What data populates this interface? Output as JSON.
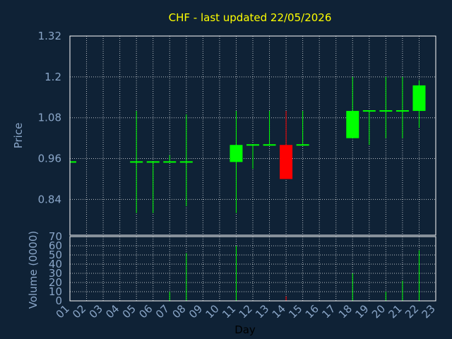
{
  "chart_data": {
    "type": "candlestick",
    "title": "CHF - last updated 22/05/2026",
    "xlabel": "Day",
    "ylabel": "Price",
    "volume_label": "Volume (0000)",
    "x_ticks": [
      "01",
      "02",
      "03",
      "04",
      "05",
      "06",
      "07",
      "08",
      "09",
      "10",
      "11",
      "12",
      "13",
      "14",
      "15",
      "16",
      "17",
      "18",
      "19",
      "20",
      "21",
      "22",
      "23"
    ],
    "price_ticks": [
      0.84,
      0.96,
      1.08,
      1.2,
      1.32
    ],
    "price_tick_labels": [
      "0.84",
      "0.96",
      "1.08",
      "1.2",
      "1.32"
    ],
    "price_range": [
      0.735,
      1.32
    ],
    "volume_ticks": [
      0,
      10,
      20,
      30,
      40,
      50,
      60,
      70
    ],
    "volume_range": [
      0,
      70
    ],
    "grid": true,
    "colors": {
      "background": "#0f2236",
      "up": "#00ff00",
      "down": "#ff0000",
      "grid": "#ffffff",
      "axis": "#8aa6c8",
      "title": "#ffff00"
    },
    "candles": [
      {
        "day": "01",
        "open": 0.95,
        "close": 0.95,
        "high": 0.95,
        "low": 0.95,
        "volume": 0
      },
      {
        "day": "05",
        "open": 0.95,
        "close": 0.95,
        "high": 1.1,
        "low": 0.8,
        "volume": 0
      },
      {
        "day": "06",
        "open": 0.95,
        "close": 0.95,
        "high": 0.95,
        "low": 0.8,
        "volume": 0
      },
      {
        "day": "07",
        "open": 0.95,
        "close": 0.95,
        "high": 0.97,
        "low": 0.95,
        "volume": 10
      },
      {
        "day": "08",
        "open": 0.95,
        "close": 0.95,
        "high": 1.09,
        "low": 0.82,
        "volume": 52
      },
      {
        "day": "11",
        "open": 0.95,
        "close": 1.0,
        "high": 1.1,
        "low": 0.8,
        "volume": 60
      },
      {
        "day": "12",
        "open": 1.0,
        "close": 1.0,
        "high": 1.0,
        "low": 0.93,
        "volume": 0
      },
      {
        "day": "13",
        "open": 1.0,
        "close": 1.0,
        "high": 1.1,
        "low": 1.0,
        "volume": 0
      },
      {
        "day": "14",
        "open": 1.0,
        "close": 0.9,
        "high": 1.1,
        "low": 0.9,
        "volume": 5
      },
      {
        "day": "15",
        "open": 1.0,
        "close": 1.0,
        "high": 1.1,
        "low": 1.0,
        "volume": 0
      },
      {
        "day": "18",
        "open": 1.02,
        "close": 1.1,
        "high": 1.2,
        "low": 1.02,
        "volume": 30
      },
      {
        "day": "19",
        "open": 1.1,
        "close": 1.1,
        "high": 1.1,
        "low": 1.0,
        "volume": 0
      },
      {
        "day": "20",
        "open": 1.1,
        "close": 1.1,
        "high": 1.2,
        "low": 1.02,
        "volume": 10
      },
      {
        "day": "21",
        "open": 1.1,
        "close": 1.1,
        "high": 1.2,
        "low": 1.02,
        "volume": 22
      },
      {
        "day": "22",
        "open": 1.1,
        "close": 1.175,
        "high": 1.19,
        "low": 1.05,
        "volume": 55
      }
    ]
  }
}
